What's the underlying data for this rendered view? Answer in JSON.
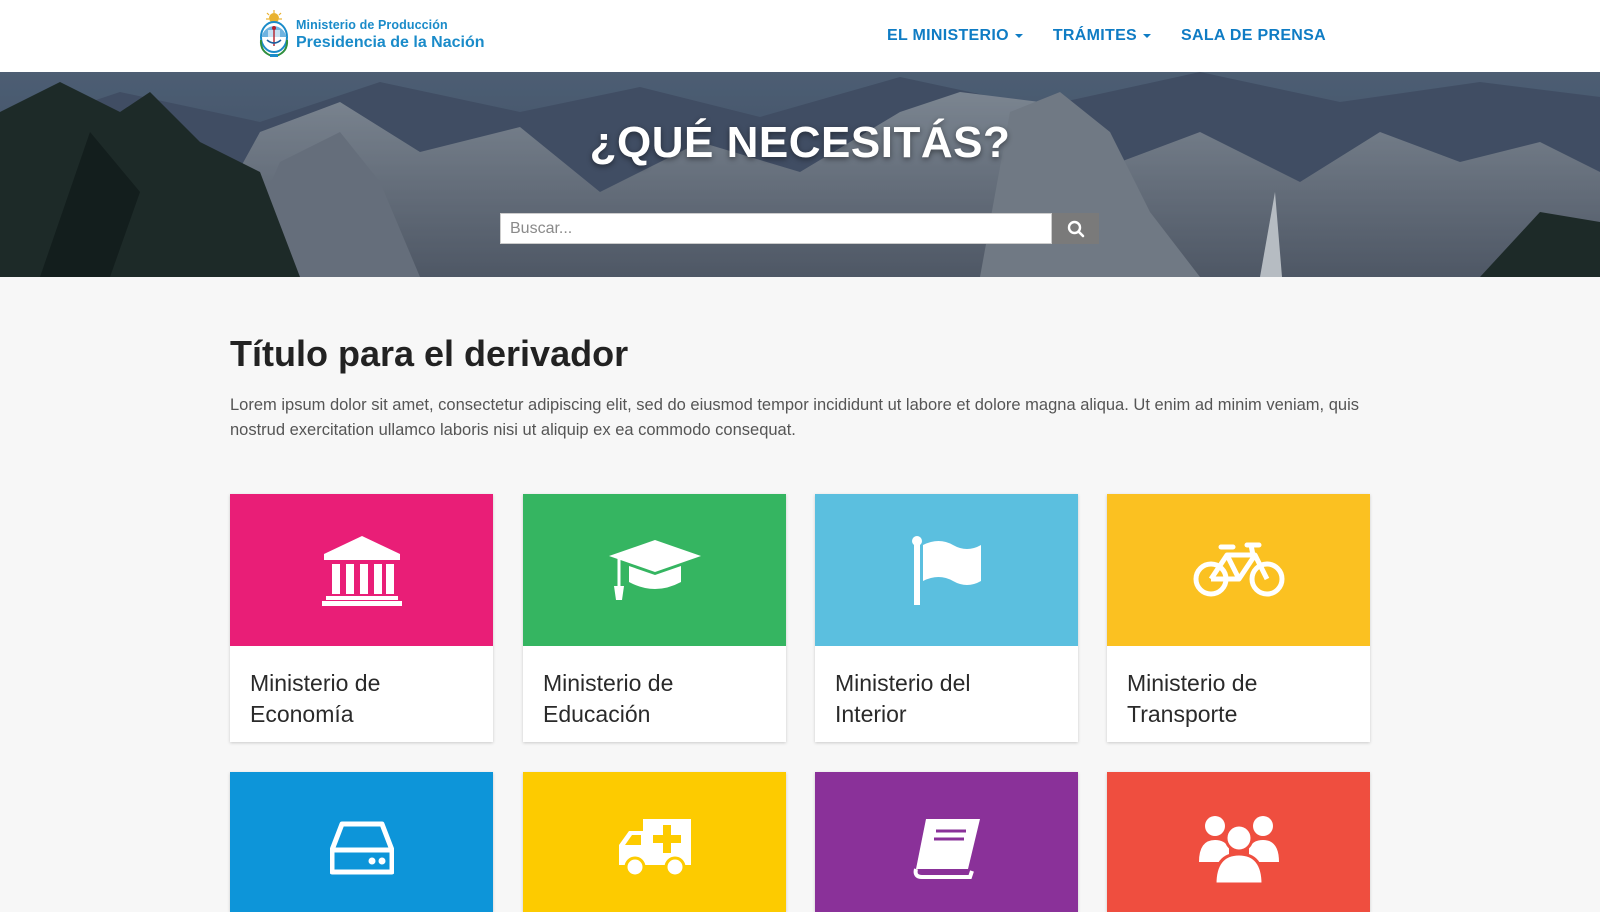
{
  "header": {
    "logo_line1": "Ministerio de Producción",
    "logo_line2": "Presidencia de la Nación",
    "nav": [
      {
        "label": "EL MINISTERIO",
        "dropdown": true
      },
      {
        "label": "TRÁMITES",
        "dropdown": true
      },
      {
        "label": "SALA DE PRENSA",
        "dropdown": false
      }
    ]
  },
  "hero": {
    "title": "¿QUÉ NECESITÁS?",
    "search_placeholder": "Buscar...",
    "search_value": ""
  },
  "main": {
    "title": "Título para el derivador",
    "description": "Lorem ipsum dolor sit amet, consectetur adipiscing elit, sed do eiusmod tempor incididunt ut labore et dolore magna aliqua. Ut enim ad minim veniam, quis nostrud exercitation ullamco laboris nisi ut aliquip ex ea commodo consequat."
  },
  "cards": [
    {
      "line1": "Ministerio de",
      "line2": "Economía",
      "color": "#e91e77",
      "icon": "bank-icon"
    },
    {
      "line1": "Ministerio de",
      "line2": "Educación",
      "color": "#35b561",
      "icon": "graduation-cap-icon"
    },
    {
      "line1": "Ministerio del",
      "line2": "Interior",
      "color": "#5bbfdf",
      "icon": "flag-icon"
    },
    {
      "line1": "Ministerio de",
      "line2": "Transporte",
      "color": "#fbc121",
      "icon": "bicycle-icon"
    },
    {
      "line1": "",
      "line2": "",
      "color": "#0d95d9",
      "icon": "hard-drive-icon"
    },
    {
      "line1": "",
      "line2": "",
      "color": "#fdcb00",
      "icon": "ambulance-icon"
    },
    {
      "line1": "",
      "line2": "",
      "color": "#8a3199",
      "icon": "book-icon"
    },
    {
      "line1": "",
      "line2": "",
      "color": "#ef4e3f",
      "icon": "users-icon"
    }
  ],
  "colors": {
    "nav_link": "#0f7cc4",
    "search_button": "#7a7a7a",
    "page_background": "#f7f7f7"
  }
}
